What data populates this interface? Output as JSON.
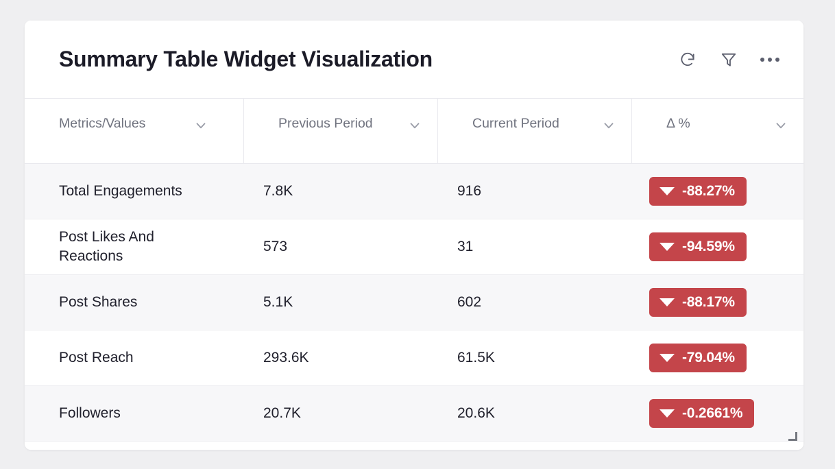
{
  "widget": {
    "title": "Summary Table Widget Visualization",
    "actions": [
      {
        "name": "refresh-icon",
        "label": "Refresh"
      },
      {
        "name": "filter-icon",
        "label": "Filter"
      },
      {
        "name": "more-options-icon",
        "label": "More options"
      }
    ],
    "resize_handle_label": "Resize widget"
  },
  "table": {
    "columns": [
      {
        "key": "metric",
        "label": "Metrics/Values"
      },
      {
        "key": "previous",
        "label": "Previous Period"
      },
      {
        "key": "current",
        "label": "Current Period"
      },
      {
        "key": "delta",
        "label": "Δ %"
      }
    ],
    "rows": [
      {
        "metric": "Total Engagements",
        "previous": "7.8K",
        "current": "916",
        "delta": "-88.27%",
        "delta_direction": "down"
      },
      {
        "metric": "Post Likes And Reactions",
        "previous": "573",
        "current": "31",
        "delta": "-94.59%",
        "delta_direction": "down"
      },
      {
        "metric": "Post Shares",
        "previous": "5.1K",
        "current": "602",
        "delta": "-88.17%",
        "delta_direction": "down"
      },
      {
        "metric": "Post Reach",
        "previous": "293.6K",
        "current": "61.5K",
        "delta": "-79.04%",
        "delta_direction": "down"
      },
      {
        "metric": "Followers",
        "previous": "20.7K",
        "current": "20.6K",
        "delta": "-0.2661%",
        "delta_direction": "down"
      }
    ]
  },
  "colors": {
    "page_background": "#efeff1",
    "card_background": "#ffffff",
    "row_stripe": "#f7f7f9",
    "title_text": "#1b1b27",
    "header_text": "#70737f",
    "cell_text": "#20202c",
    "negative_badge": "#c4454a",
    "badge_text": "#ffffff",
    "divider": "#e9e9ee"
  }
}
